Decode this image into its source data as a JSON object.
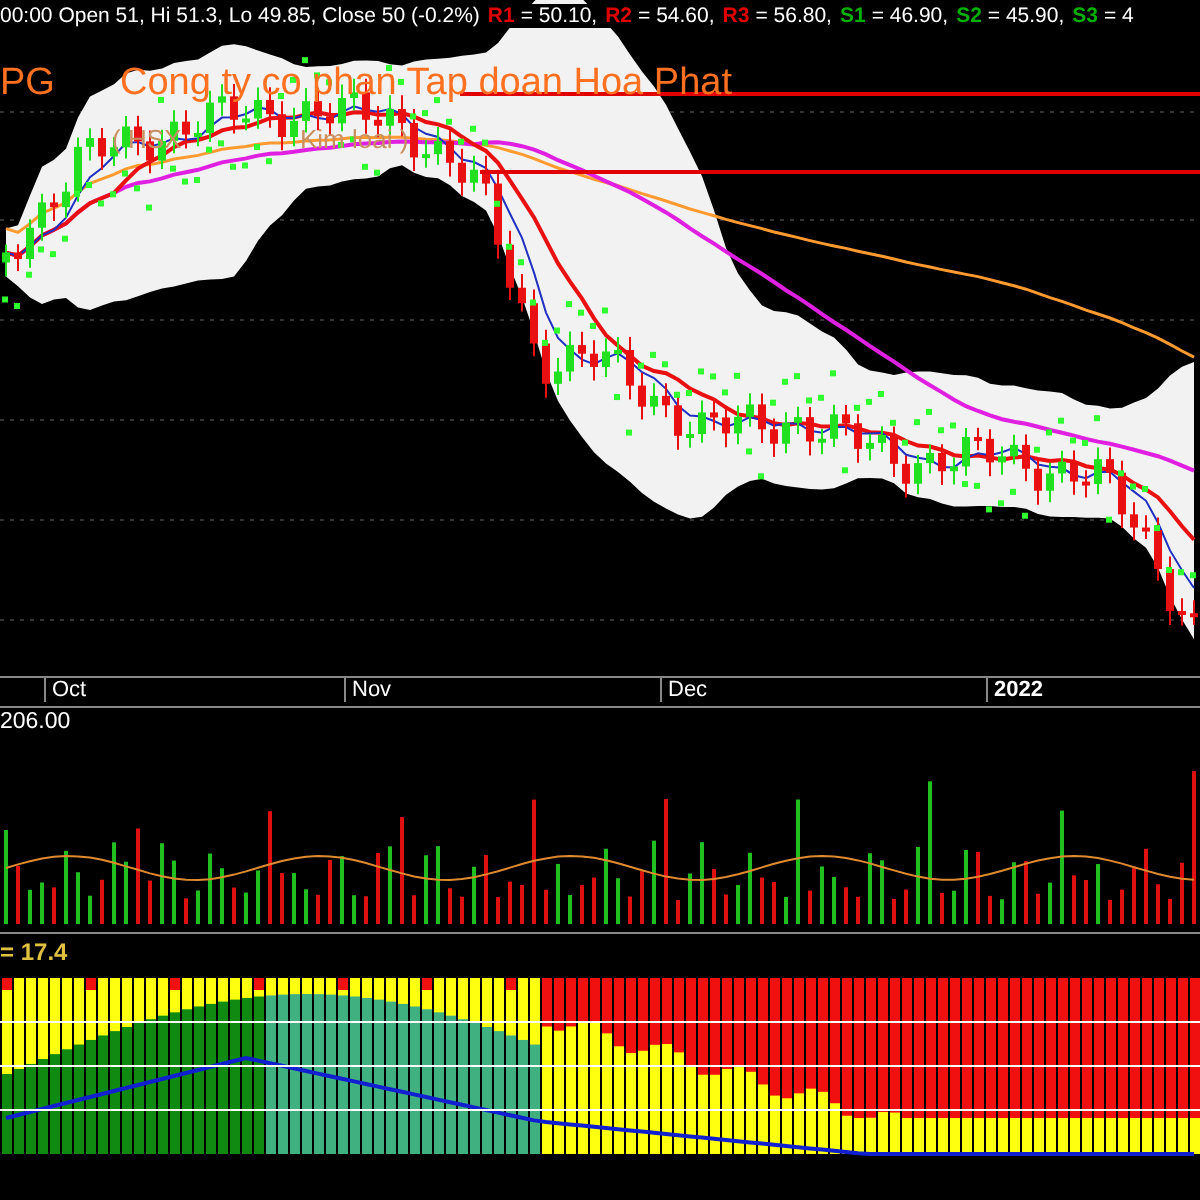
{
  "header": {
    "quote": "00:00 Open 51, Hi 51.3, Lo 49.85, Close 50 (-0.2%)",
    "pivots": [
      {
        "label": "R1",
        "value": "= 50.10,",
        "color": "#e00000"
      },
      {
        "label": "R2",
        "value": "= 54.60,",
        "color": "#e00000"
      },
      {
        "label": "R3",
        "value": "= 56.80,",
        "color": "#e00000"
      },
      {
        "label": "S1",
        "value": "= 46.90,",
        "color": "#00b000"
      },
      {
        "label": "S2",
        "value": "= 45.90,",
        "color": "#00b000"
      },
      {
        "label": "S3",
        "value": "= 4",
        "color": "#00b000"
      }
    ]
  },
  "symbol": {
    "ticker": "PG",
    "company": "Cong ty co phan Tap doan Hoa Phat",
    "exchange": "( HSX",
    "industry": "Kim loai )"
  },
  "date_axis": [
    {
      "label": "Oct",
      "bold": false
    },
    {
      "label": "Nov",
      "bold": false
    },
    {
      "label": "Dec",
      "bold": false
    },
    {
      "label": "2022",
      "bold": true
    }
  ],
  "volume_panel": {
    "reading": "206.00"
  },
  "indicator_panel": {
    "reading": "= 17.4"
  }
}
